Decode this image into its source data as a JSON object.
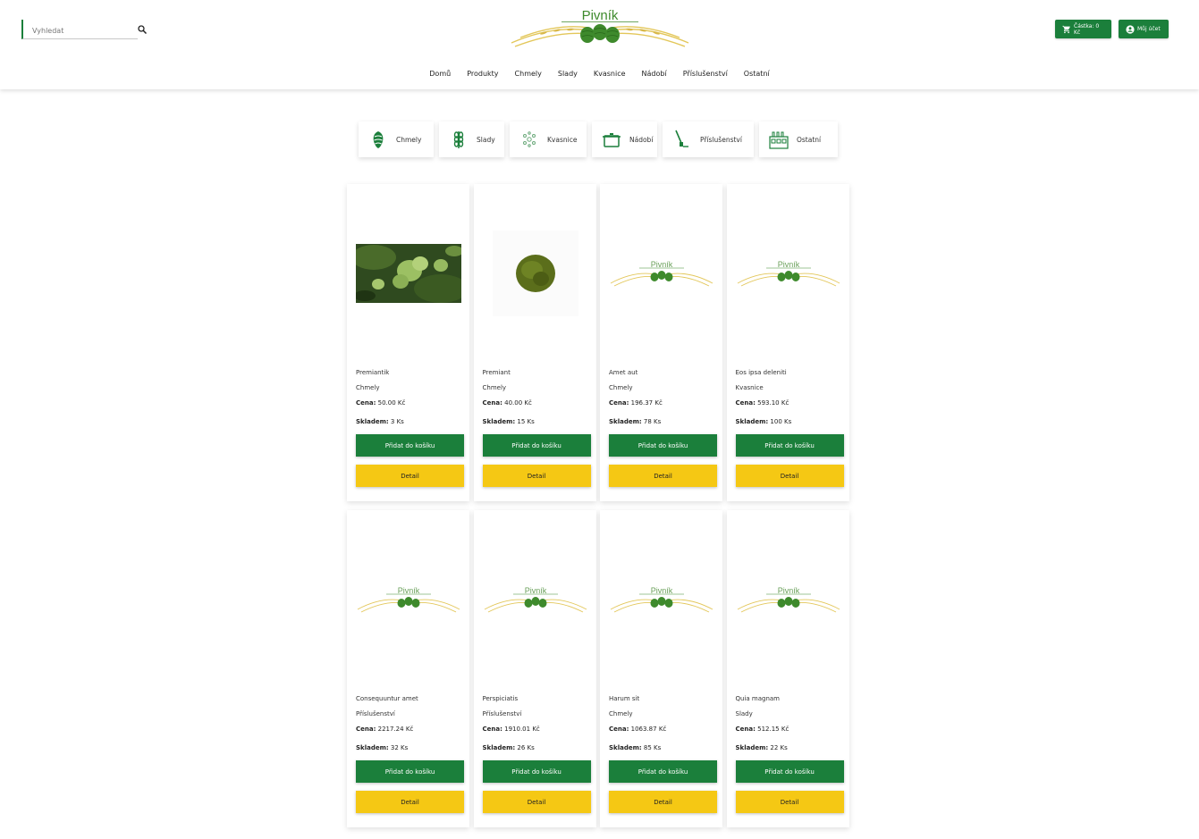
{
  "header": {
    "search_placeholder": "Vyhledat",
    "logo_text": "Pivník",
    "cart_label": "Částka: 0 Kč",
    "account_label": "Můj účet",
    "nav": [
      "Domů",
      "Produkty",
      "Chmely",
      "Slady",
      "Kvasnice",
      "Nádobí",
      "Příslušenství",
      "Ostatní"
    ]
  },
  "categories": [
    "Chmely",
    "Slady",
    "Kvasnice",
    "Nádobí",
    "Příslušenství",
    "Ostatní"
  ],
  "products": [
    {
      "name": "Premiantik",
      "category": "Chmely",
      "price_label": "Cena:",
      "price": "50.00 Kč",
      "stock_label": "Skladem:",
      "stock": "3 Ks",
      "image": "hops-photo"
    },
    {
      "name": "Premiant",
      "category": "Chmely",
      "price_label": "Cena:",
      "price": "40.00 Kč",
      "stock_label": "Skladem:",
      "stock": "15 Ks",
      "image": "pellet-photo"
    },
    {
      "name": "Amet aut",
      "category": "Chmely",
      "price_label": "Cena:",
      "price": "196.37 Kč",
      "stock_label": "Skladem:",
      "stock": "78 Ks",
      "image": "logo"
    },
    {
      "name": "Eos ipsa deleniti",
      "category": "Kvasnice",
      "price_label": "Cena:",
      "price": "593.10 Kč",
      "stock_label": "Skladem:",
      "stock": "100 Ks",
      "image": "logo"
    },
    {
      "name": "Consequuntur amet",
      "category": "Příslušenství",
      "price_label": "Cena:",
      "price": "2217.24 Kč",
      "stock_label": "Skladem:",
      "stock": "32 Ks",
      "image": "logo"
    },
    {
      "name": "Perspiciatis",
      "category": "Příslušenství",
      "price_label": "Cena:",
      "price": "1910.01 Kč",
      "stock_label": "Skladem:",
      "stock": "26 Ks",
      "image": "logo"
    },
    {
      "name": "Harum sit",
      "category": "Chmely",
      "price_label": "Cena:",
      "price": "1063.87 Kč",
      "stock_label": "Skladem:",
      "stock": "85 Ks",
      "image": "logo"
    },
    {
      "name": "Quia magnam",
      "category": "Slady",
      "price_label": "Cena:",
      "price": "512.15 Kč",
      "stock_label": "Skladem:",
      "stock": "22 Ks",
      "image": "logo"
    }
  ],
  "buttons": {
    "add_to_cart": "Přidat do košíku",
    "detail": "Detail"
  },
  "colors": {
    "primary": "#1b7f3b",
    "accent": "#f5c814",
    "logo_green": "#3e8a2c",
    "logo_wheat": "#e3c75a"
  }
}
